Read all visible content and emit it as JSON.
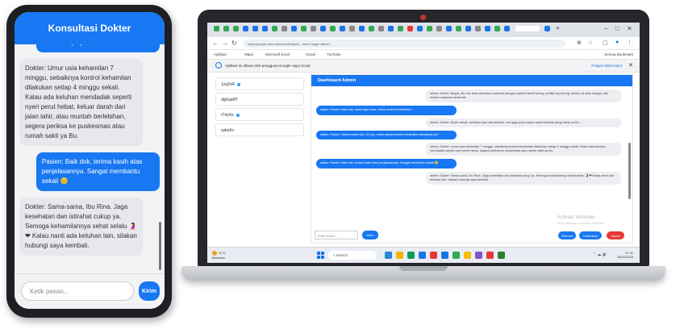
{
  "phone": {
    "header_title": "Konsultasi Dokter",
    "messages": [
      {
        "role": "user",
        "text": "... sebaiknya ya?",
        "cut": true
      },
      {
        "role": "bot",
        "text": "Dokter: Umur usia kehamilan 7 minggu, sebaiknya kontrol kehamilan dilakukan setiap 4 minggu sekali. Kalau ada keluhan mendadak seperti nyeri perut hebat, keluar darah dari jalan lahir, atau muntah berlebihan, segera periksa ke puskesmas atau rumah sakit ya Bu."
      },
      {
        "role": "user",
        "text": "Pasien: Baik dok, terima kasih atas penjelasannya. Sangat membantu sekali 😊"
      },
      {
        "role": "bot",
        "text": "Dokter: Sama-sama, Ibu Rina. Jaga kesehatan dan istirahat cukup ya. Semoga kehamilannya sehat selalu 🤰❤ Kalau nanti ada keluhan lain, silakan hubungi saya kembali."
      }
    ],
    "input_placeholder": "Ketik pesan...",
    "send_label": "Kirim"
  },
  "browser": {
    "url": "script.google.com/macros/s/AKfycbz.../exec?page=admin",
    "bookmarks": [
      "Aplikasi",
      "Maps",
      "Microsoft Excel",
      "Gmail",
      "YouTube"
    ],
    "all_bookmarks": "Semua Bookmark",
    "infobar_text": "Aplikasi ini dibuat oleh pengguna Google Apps Script",
    "infobar_action": "Pelajari lebih lanjut"
  },
  "sidebar": {
    "items": [
      "1zq2xR",
      "dgKqw8T",
      "iT4yKe",
      "xpbsKv"
    ]
  },
  "admin": {
    "title": "Dashboard Admin",
    "messages": [
      {
        "role": "bot",
        "text": "admin: Dokter: Bagus, Bu. Ibu bisa mencoba makanan dengan seperti biskuit kering, sedikit tapi sering, minum air jahe hangat, dan hindari makanan berlemak."
      },
      {
        "role": "user",
        "text": "status: Pasien: Baik dok, nanti saya coba. Untuk kontrol kehamilan?"
      },
      {
        "role": "bot",
        "text": "admin: Dokter: Boleh sekali, ceritakan jika ada keluhan, dan jaga pola makan serta istirahat yang cukup ya Bu."
      },
      {
        "role": "user",
        "text": "status: Pasien: Terima kasih dok. Oh iya, untuk jadwal kontrol kehamilan sebaiknya ya?"
      },
      {
        "role": "bot",
        "text": "admin: Dokter: Umur usia kehamilan 7 minggu, sebaiknya kontrol kehamilan dilakukan setiap 4 minggu sekali. Kalau ada keluhan mendadak seperti nyeri perut hebat, segera periksa ke puskesmas atau rumah sakit ya Bu."
      },
      {
        "role": "user",
        "text": "status: Pasien: Baik dok, terima kasih atas penjelasannya. Sangat membantu sekali 😊"
      },
      {
        "role": "bot",
        "text": "admin: Dokter: Sama-sama, Ibu Rina. Jaga kesehatan dan istirahat cukup ya. Semoga kehamilannya sehat selalu 🤰❤ Kalau nanti ada keluhan lain, silakan hubungi saya kembali."
      }
    ],
    "input_placeholder": "Ketik pesan...",
    "send_label": "Kirim",
    "watermark_title": "Activate Windows",
    "watermark_sub": "Go to Settings to activate Windows.",
    "buttons": [
      {
        "label": "Refresh",
        "color": "#1877f2"
      },
      {
        "label": "Unduhkan",
        "color": "#1877f2"
      },
      {
        "label": "Hapus",
        "color": "#e53935"
      }
    ]
  },
  "taskbar": {
    "weather_temp": "31°C",
    "weather_desc": "Berawan",
    "search_label": "Search",
    "time": "07.41",
    "date": "06/11/2025"
  },
  "colors": {
    "accent": "#1877f2",
    "danger": "#e53935"
  }
}
